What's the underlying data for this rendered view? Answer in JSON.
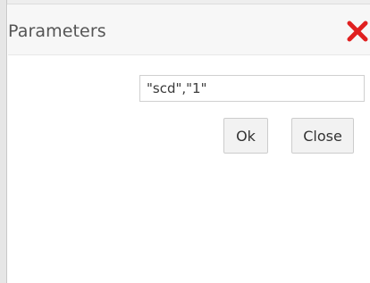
{
  "dialog": {
    "title": "Parameters",
    "close_icon": "close-x-icon",
    "close_icon_color": "#e02020",
    "parameter_value": "\"scd\",\"1\"",
    "ok_label": "Ok",
    "close_label": "Close"
  }
}
